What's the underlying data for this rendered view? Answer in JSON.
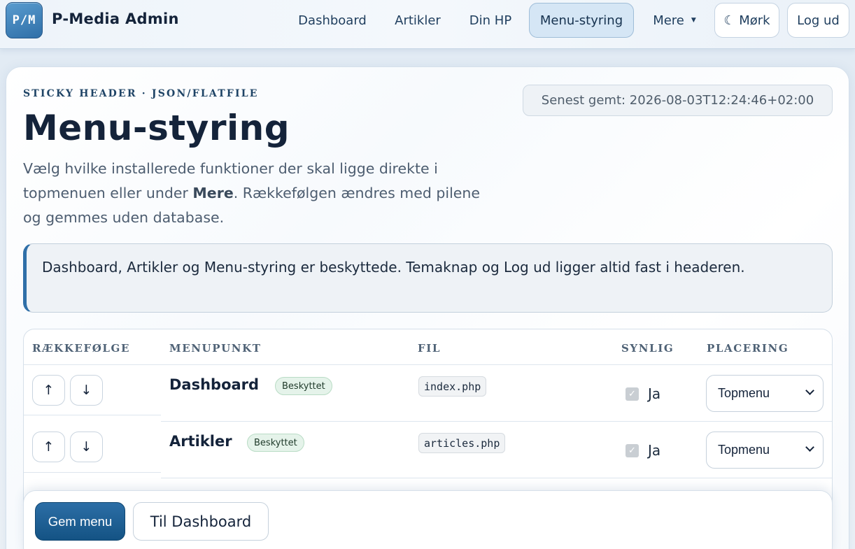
{
  "app": {
    "logo_text": "P/M",
    "title": "P-Media Admin"
  },
  "nav": {
    "items": [
      {
        "label": "Dashboard",
        "active": false
      },
      {
        "label": "Artikler",
        "active": false
      },
      {
        "label": "Din HP",
        "active": false
      },
      {
        "label": "Menu-styring",
        "active": true
      },
      {
        "label": "Mere",
        "active": false,
        "has_dropdown": true
      }
    ],
    "theme_toggle": "☾ Mørk",
    "logout": "Log ud"
  },
  "page": {
    "eyebrow": "STICKY HEADER · JSON/FLATFILE",
    "title": "Menu-styring",
    "lead_part1": "Vælg hvilke installerede funktioner der skal ligge direkte i topmenuen eller under ",
    "lead_bold": "Mere",
    "lead_part2": ". Rækkefølgen ændres med pilene og gemmes uden database.",
    "saved": "Senest gemt: 2026-08-03T12:24:46+02:00",
    "notice": "Dashboard, Artikler og Menu-styring er beskyttede. Temaknap og Log ud ligger altid fast i headeren."
  },
  "table": {
    "headers": {
      "order": "RÆKKEFØLGE",
      "item": "MENUPUNKT",
      "file": "FIL",
      "visible": "SYNLIG",
      "placement": "PLACERING"
    },
    "up_label": "↑",
    "down_label": "↓",
    "rows": [
      {
        "name": "Dashboard",
        "tag": "Beskyttet",
        "file": "index.php",
        "visible_label": "Ja",
        "checked": true,
        "placement": "Topmenu"
      },
      {
        "name": "Artikler",
        "tag": "Beskyttet",
        "file": "articles.php",
        "visible_label": "Ja",
        "checked": true,
        "placement": "Topmenu"
      }
    ]
  },
  "actions": {
    "save": "Gem menu",
    "back": "Til Dashboard"
  },
  "colors": {
    "accent": "#2f6fa8",
    "primary_button": "#145384",
    "tag_bg": "#e5f3ea"
  }
}
